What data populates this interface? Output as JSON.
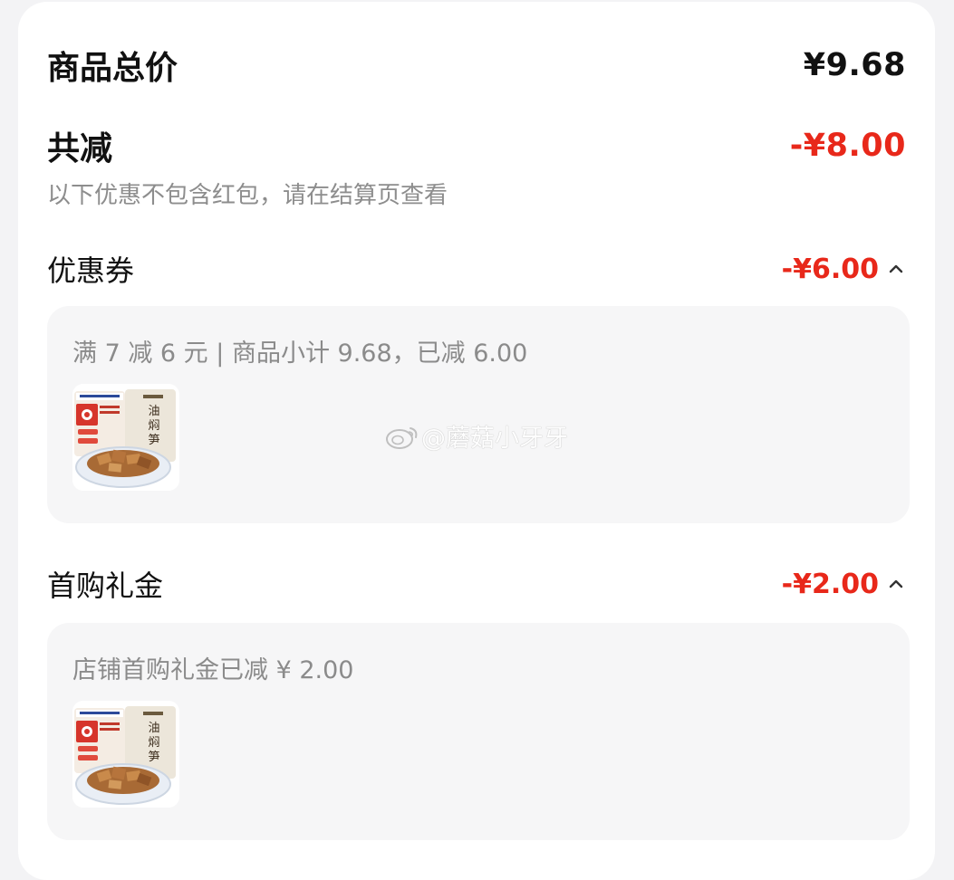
{
  "summary": {
    "total_label": "商品总价",
    "total_value": "¥9.68",
    "discount_label": "共减",
    "discount_value": "-¥8.00",
    "note": "以下优惠不包含红包，请在结算页查看"
  },
  "coupon": {
    "label": "优惠券",
    "value": "-¥6.00",
    "detail": "满 7 减 6 元 | 商品小计 9.68，已减 6.00",
    "chevron_icon": "chevron-up-icon"
  },
  "first_purchase": {
    "label": "首购礼金",
    "value": "-¥2.00",
    "detail": "店铺首购礼金已减 ¥ 2.00",
    "chevron_icon": "chevron-up-icon"
  },
  "watermark": {
    "text": "@蘑菇小牙牙"
  },
  "colors": {
    "accent_red": "#e8281a",
    "text_dark": "#111111",
    "text_gray": "#8d8d8d",
    "panel_bg": "#f6f6f7",
    "page_bg": "#f3f3f5"
  }
}
